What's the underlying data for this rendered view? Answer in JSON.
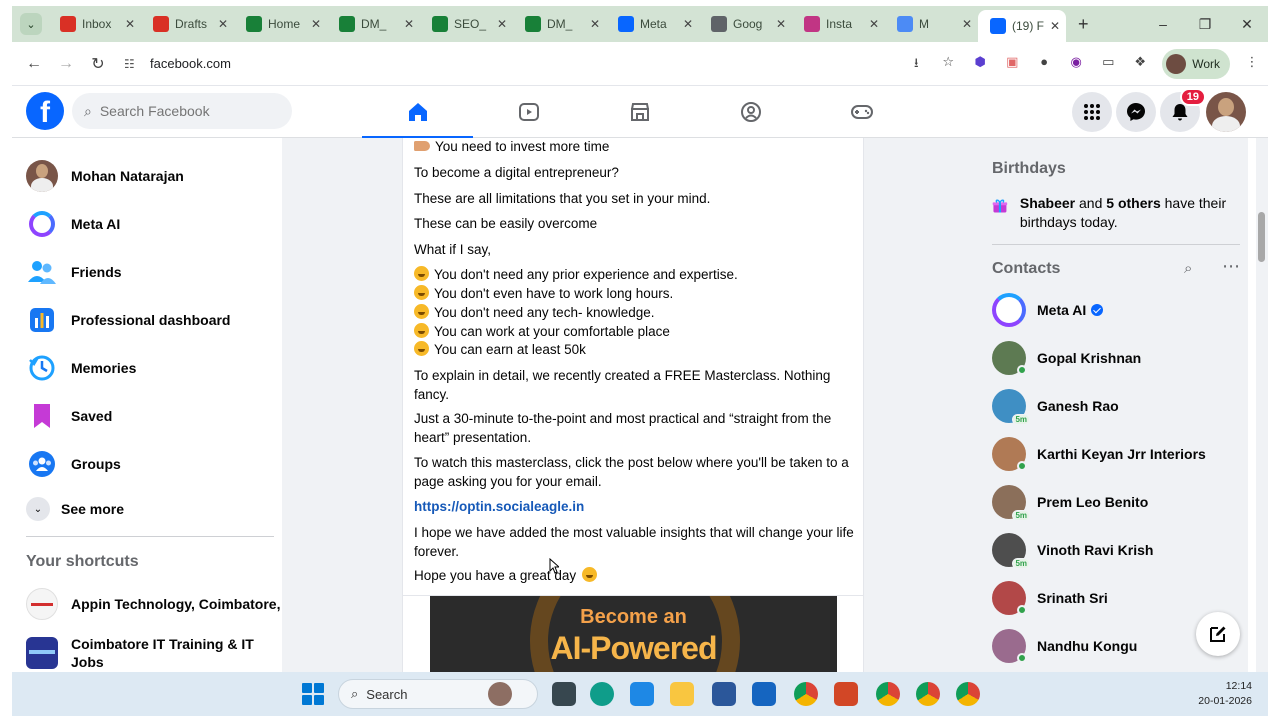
{
  "browser": {
    "tabs": [
      {
        "label": "Inbox",
        "icon": "gmail-icon",
        "color": "#d93025"
      },
      {
        "label": "Drafts",
        "icon": "gmail-icon",
        "color": "#d93025"
      },
      {
        "label": "Home",
        "icon": "drive-icon",
        "color": "#188038"
      },
      {
        "label": "DM_",
        "icon": "sheets-icon",
        "color": "#188038"
      },
      {
        "label": "SEO_",
        "icon": "sheets-icon",
        "color": "#188038"
      },
      {
        "label": "DM_",
        "icon": "sheets-icon",
        "color": "#188038"
      },
      {
        "label": "Meta",
        "icon": "meta-icon",
        "color": "#0866ff"
      },
      {
        "label": "Goog",
        "icon": "google-icon",
        "color": "#5f6368"
      },
      {
        "label": "Insta",
        "icon": "instagram-icon",
        "color": "#c13584"
      },
      {
        "label": "M",
        "icon": "gemini-icon",
        "color": "#4c8bf5"
      },
      {
        "label": "(19) F",
        "icon": "facebook-icon",
        "color": "#0866ff",
        "active": true
      }
    ],
    "url": "facebook.com",
    "profile_label": "Work"
  },
  "fb": {
    "search_placeholder": "Search Facebook",
    "notifications_count": "19",
    "colors": {
      "brand": "#0866ff",
      "text": "#050505",
      "secondary": "#65676b",
      "background": "#f0f2f5",
      "link": "#1659b8",
      "online": "#31a24c"
    }
  },
  "left_nav": {
    "items": [
      {
        "label": "Mohan Natarajan",
        "icon": "profile-avatar"
      },
      {
        "label": "Meta AI",
        "icon": "meta-ai-icon"
      },
      {
        "label": "Friends",
        "icon": "friends-icon"
      },
      {
        "label": "Professional dashboard",
        "icon": "dashboard-icon"
      },
      {
        "label": "Memories",
        "icon": "memories-icon"
      },
      {
        "label": "Saved",
        "icon": "saved-icon"
      },
      {
        "label": "Groups",
        "icon": "groups-icon"
      }
    ],
    "see_more": "See more",
    "shortcuts_title": "Your shortcuts",
    "shortcuts": [
      {
        "label": "Appin Technology, Coimbatore,"
      },
      {
        "label": "Coimbatore IT Training & IT Jobs"
      }
    ]
  },
  "post": {
    "lines": [
      "You need to invest more time",
      "To become a digital entrepreneur?",
      "These are all limitations that you set in your mind.",
      "These can be easily overcome",
      "What if I say,",
      "You don't need any prior experience and expertise.",
      "You don't even have to work long hours.",
      "You don't need any tech- knowledge.",
      "You can work at your comfortable place",
      "You can earn at least 50k",
      "To explain in detail, we recently created a FREE Masterclass. Nothing fancy.",
      "Just a 30-minute to-the-point and most practical and “straight from the heart” presentation.",
      "To watch this masterclass, click the post below where you'll be taken to a page asking you for your email.",
      "https://optin.socialeagle.in",
      "I hope we have added the most valuable insights that will change your life forever.",
      "Hope you have a great day"
    ],
    "image_line1": "Become an",
    "image_line2": "AI-Powered"
  },
  "right": {
    "birthdays_title": "Birthdays",
    "birthday_name": "Shabeer",
    "birthday_and": " and ",
    "birthday_others": "5 others",
    "birthday_rest": " have their birthdays today.",
    "contacts_title": "Contacts",
    "contacts": [
      {
        "name": "Meta AI",
        "verified": true,
        "status": ""
      },
      {
        "name": "Gopal Krishnan",
        "status": "online"
      },
      {
        "name": "Ganesh Rao",
        "status": "5m"
      },
      {
        "name": "Karthi Keyan Jrr Interiors",
        "status": "online"
      },
      {
        "name": "Prem Leo Benito",
        "status": "5m"
      },
      {
        "name": "Vinoth Ravi Krish",
        "status": "5m"
      },
      {
        "name": "Srinath Sri",
        "status": "online"
      },
      {
        "name": "Nandhu Kongu",
        "status": "online"
      }
    ]
  },
  "taskbar": {
    "search_label": "Search",
    "time": "12:14",
    "date": "20-01-2026"
  }
}
